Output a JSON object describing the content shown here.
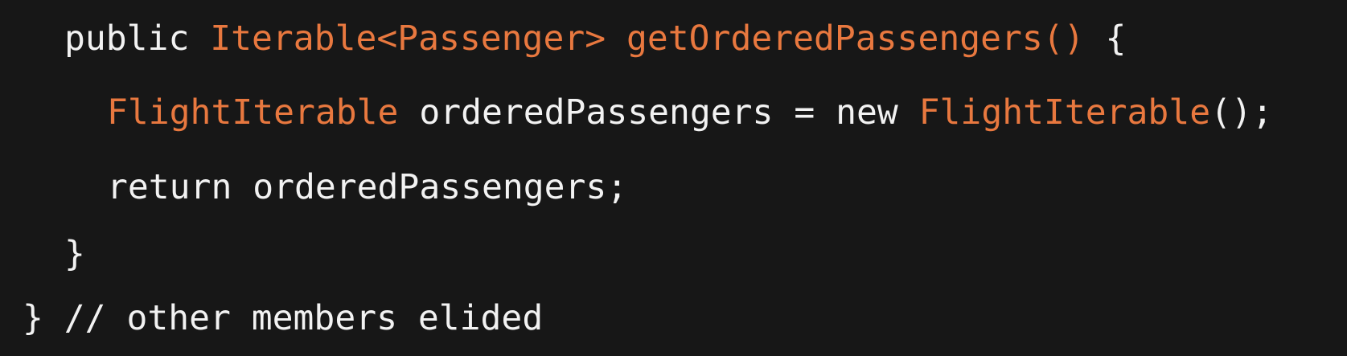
{
  "colors": {
    "background": "#171717",
    "text": "#f2f2f2",
    "accent": "#e8783f"
  },
  "code": {
    "line1": {
      "kw_public": "public",
      "space1": " ",
      "type": "Iterable<Passenger>",
      "space2": " ",
      "method": "getOrderedPassengers()",
      "brace": " {"
    },
    "line2": {
      "type": "FlightIterable",
      "decl": " orderedPassengers = new ",
      "ctor": "FlightIterable",
      "end": "();"
    },
    "line3": {
      "text": "return orderedPassengers;"
    },
    "line4": {
      "text": "}"
    },
    "line5": {
      "text": "} // other members elided"
    }
  }
}
